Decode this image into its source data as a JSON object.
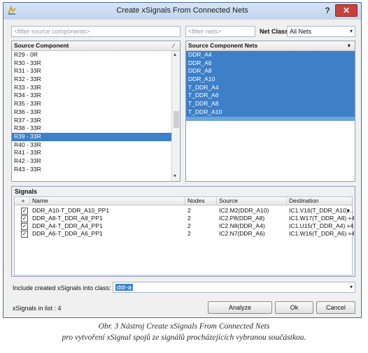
{
  "window": {
    "title": "Create xSignals From Connected Nets",
    "help_label": "?",
    "close_label": "✕",
    "app_icon": "signal-app-icon"
  },
  "filters": {
    "source_components_placeholder": "<filter source components>",
    "nets_placeholder": "<filter nets>",
    "net_class_label": "Net Class",
    "net_class_value": "All Nets"
  },
  "source_component": {
    "header": "Source Component",
    "header_icon": "pin-icon",
    "items": [
      "R29 - 0R",
      "R30 - 33R",
      "R31 - 33R",
      "R32 - 33R",
      "R33 - 33R",
      "R34 - 33R",
      "R35 - 33R",
      "R36 - 33R",
      "R37 - 33R",
      "R38 - 33R",
      "R39 - 33R",
      "R40 - 33R",
      "R41 - 33R",
      "R42 - 33R",
      "R43 - 33R"
    ],
    "selected_index": 10
  },
  "source_component_nets": {
    "header": "Source Component Nets",
    "items": [
      "DDR_A4",
      "DDR_A6",
      "DDR_A8",
      "DDR_A10",
      "T_DDR_A4",
      "T_DDR_A6",
      "T_DDR_A8",
      "T_DDR_A10"
    ]
  },
  "signals": {
    "section_label": "Signals",
    "columns": {
      "plus": "+",
      "name": "Name",
      "nodes": "Nodes",
      "source": "Source",
      "destination": "Destination"
    },
    "rows": [
      {
        "checked": true,
        "name": "DDR_A10-T_DDR_A10_PP1",
        "nodes": "2",
        "source": "IC2.M2(DDR_A10)",
        "destination": "IC1.V16(T_DDR_A10)..."
      },
      {
        "checked": true,
        "name": "DDR_A8-T_DDR_A8_PP1",
        "nodes": "2",
        "source": "IC2.P8(DDR_A8)",
        "destination": "IC1.W17(T_DDR_A8) +4"
      },
      {
        "checked": true,
        "name": "DDR_A4-T_DDR_A4_PP1",
        "nodes": "2",
        "source": "IC2.N8(DDR_A4)",
        "destination": "IC1.U15(T_DDR_A4) +4"
      },
      {
        "checked": true,
        "name": "DDR_A6-T_DDR_A6_PP1",
        "nodes": "2",
        "source": "IC2.N7(DDR_A6)",
        "destination": "IC1.W16(T_DDR_A6) +4"
      }
    ]
  },
  "include": {
    "label": "Include created xSignals into class:",
    "value": "ddr-a"
  },
  "footer": {
    "count_text": "xSignals in list : 4",
    "analyze_label": "Analyze",
    "ok_label": "Ok",
    "cancel_label": "Cancel"
  },
  "caption": {
    "line1": "Obr. 3  Nástroj Create xSignals From Connected Nets",
    "line2": "pro vytvoření xSignal spojů ze signálů procházejících vybranou součástkou."
  }
}
